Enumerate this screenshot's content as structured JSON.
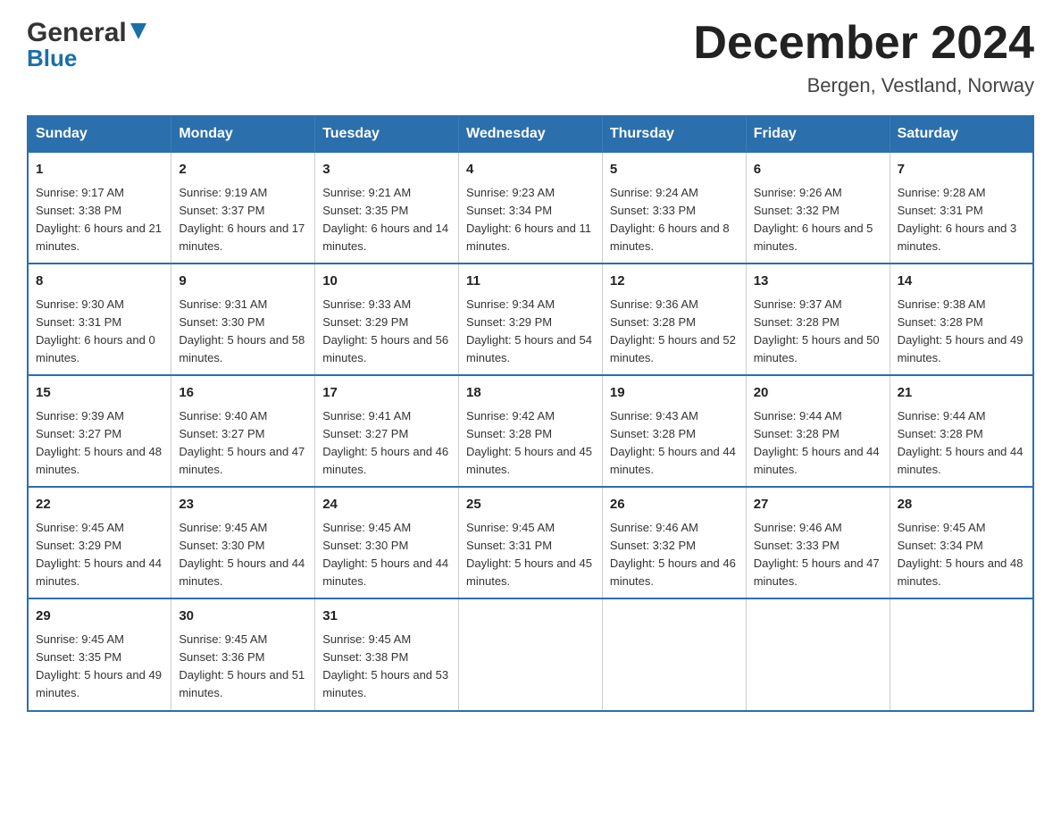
{
  "header": {
    "logo_general": "General",
    "logo_blue": "Blue",
    "main_title": "December 2024",
    "subtitle": "Bergen, Vestland, Norway"
  },
  "days_of_week": [
    "Sunday",
    "Monday",
    "Tuesday",
    "Wednesday",
    "Thursday",
    "Friday",
    "Saturday"
  ],
  "weeks": [
    [
      {
        "day": "1",
        "sunrise": "9:17 AM",
        "sunset": "3:38 PM",
        "daylight": "6 hours and 21 minutes."
      },
      {
        "day": "2",
        "sunrise": "9:19 AM",
        "sunset": "3:37 PM",
        "daylight": "6 hours and 17 minutes."
      },
      {
        "day": "3",
        "sunrise": "9:21 AM",
        "sunset": "3:35 PM",
        "daylight": "6 hours and 14 minutes."
      },
      {
        "day": "4",
        "sunrise": "9:23 AM",
        "sunset": "3:34 PM",
        "daylight": "6 hours and 11 minutes."
      },
      {
        "day": "5",
        "sunrise": "9:24 AM",
        "sunset": "3:33 PM",
        "daylight": "6 hours and 8 minutes."
      },
      {
        "day": "6",
        "sunrise": "9:26 AM",
        "sunset": "3:32 PM",
        "daylight": "6 hours and 5 minutes."
      },
      {
        "day": "7",
        "sunrise": "9:28 AM",
        "sunset": "3:31 PM",
        "daylight": "6 hours and 3 minutes."
      }
    ],
    [
      {
        "day": "8",
        "sunrise": "9:30 AM",
        "sunset": "3:31 PM",
        "daylight": "6 hours and 0 minutes."
      },
      {
        "day": "9",
        "sunrise": "9:31 AM",
        "sunset": "3:30 PM",
        "daylight": "5 hours and 58 minutes."
      },
      {
        "day": "10",
        "sunrise": "9:33 AM",
        "sunset": "3:29 PM",
        "daylight": "5 hours and 56 minutes."
      },
      {
        "day": "11",
        "sunrise": "9:34 AM",
        "sunset": "3:29 PM",
        "daylight": "5 hours and 54 minutes."
      },
      {
        "day": "12",
        "sunrise": "9:36 AM",
        "sunset": "3:28 PM",
        "daylight": "5 hours and 52 minutes."
      },
      {
        "day": "13",
        "sunrise": "9:37 AM",
        "sunset": "3:28 PM",
        "daylight": "5 hours and 50 minutes."
      },
      {
        "day": "14",
        "sunrise": "9:38 AM",
        "sunset": "3:28 PM",
        "daylight": "5 hours and 49 minutes."
      }
    ],
    [
      {
        "day": "15",
        "sunrise": "9:39 AM",
        "sunset": "3:27 PM",
        "daylight": "5 hours and 48 minutes."
      },
      {
        "day": "16",
        "sunrise": "9:40 AM",
        "sunset": "3:27 PM",
        "daylight": "5 hours and 47 minutes."
      },
      {
        "day": "17",
        "sunrise": "9:41 AM",
        "sunset": "3:27 PM",
        "daylight": "5 hours and 46 minutes."
      },
      {
        "day": "18",
        "sunrise": "9:42 AM",
        "sunset": "3:28 PM",
        "daylight": "5 hours and 45 minutes."
      },
      {
        "day": "19",
        "sunrise": "9:43 AM",
        "sunset": "3:28 PM",
        "daylight": "5 hours and 44 minutes."
      },
      {
        "day": "20",
        "sunrise": "9:44 AM",
        "sunset": "3:28 PM",
        "daylight": "5 hours and 44 minutes."
      },
      {
        "day": "21",
        "sunrise": "9:44 AM",
        "sunset": "3:28 PM",
        "daylight": "5 hours and 44 minutes."
      }
    ],
    [
      {
        "day": "22",
        "sunrise": "9:45 AM",
        "sunset": "3:29 PM",
        "daylight": "5 hours and 44 minutes."
      },
      {
        "day": "23",
        "sunrise": "9:45 AM",
        "sunset": "3:30 PM",
        "daylight": "5 hours and 44 minutes."
      },
      {
        "day": "24",
        "sunrise": "9:45 AM",
        "sunset": "3:30 PM",
        "daylight": "5 hours and 44 minutes."
      },
      {
        "day": "25",
        "sunrise": "9:45 AM",
        "sunset": "3:31 PM",
        "daylight": "5 hours and 45 minutes."
      },
      {
        "day": "26",
        "sunrise": "9:46 AM",
        "sunset": "3:32 PM",
        "daylight": "5 hours and 46 minutes."
      },
      {
        "day": "27",
        "sunrise": "9:46 AM",
        "sunset": "3:33 PM",
        "daylight": "5 hours and 47 minutes."
      },
      {
        "day": "28",
        "sunrise": "9:45 AM",
        "sunset": "3:34 PM",
        "daylight": "5 hours and 48 minutes."
      }
    ],
    [
      {
        "day": "29",
        "sunrise": "9:45 AM",
        "sunset": "3:35 PM",
        "daylight": "5 hours and 49 minutes."
      },
      {
        "day": "30",
        "sunrise": "9:45 AM",
        "sunset": "3:36 PM",
        "daylight": "5 hours and 51 minutes."
      },
      {
        "day": "31",
        "sunrise": "9:45 AM",
        "sunset": "3:38 PM",
        "daylight": "5 hours and 53 minutes."
      },
      null,
      null,
      null,
      null
    ]
  ]
}
